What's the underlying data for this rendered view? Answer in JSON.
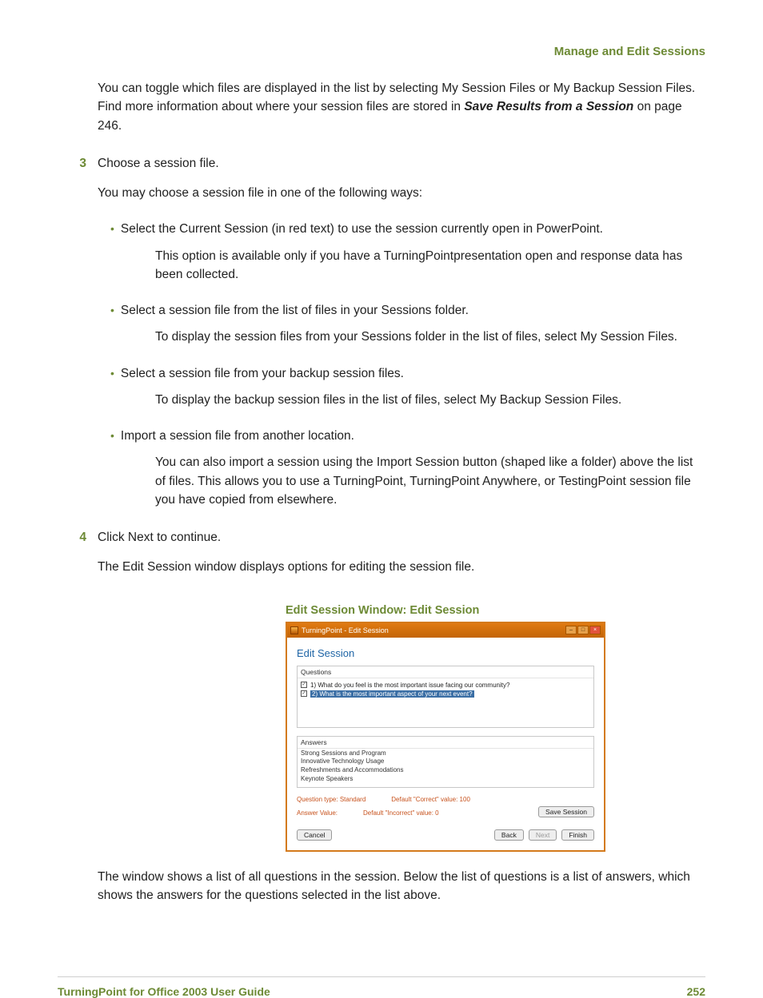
{
  "header": {
    "title": "Manage and Edit Sessions"
  },
  "intro": {
    "line1_a": "You can toggle which files are displayed in the list by selecting My Session Files or My Backup Session Files. Find more information about where your session files are stored in ",
    "xref": "Save Results from a Session",
    "line1_b": " on page 246."
  },
  "step3": {
    "num": "3",
    "title": "Choose a session file.",
    "lead": "You may choose a session file in one of the following ways:",
    "bullets": [
      {
        "t": "Select the Current Session (in red text) to use the session currently open in PowerPoint.",
        "s": "This option is available only if you have a TurningPointpresentation open and response data has been collected."
      },
      {
        "t": "Select a session file from the list of files in your Sessions folder.",
        "s": "To display the session files from your Sessions folder in the list of files, select My Session Files."
      },
      {
        "t": "Select a session file from your backup session files.",
        "s": "To display the backup session files in the list of files, select My Backup Session Files."
      },
      {
        "t": "Import a session file from another location.",
        "s": "You can also import a session using the Import Session button (shaped like a folder) above the list of files. This allows you to use a TurningPoint, TurningPoint Anywhere, or TestingPoint session file you have copied from elsewhere."
      }
    ]
  },
  "step4": {
    "num": "4",
    "title": "Click Next to continue.",
    "sub": "The Edit Session window displays options for editing the session file."
  },
  "figure": {
    "caption": "Edit Session Window: Edit Session",
    "titlebar": "TurningPoint - Edit Session",
    "heading": "Edit Session",
    "questions_label": "Questions",
    "questions": [
      "1) What do you feel is the most important issue facing our community?",
      "2) What is the most important aspect of your next event?"
    ],
    "answers_label": "Answers",
    "answers": [
      "Strong Sessions and Program",
      "Innovative Technology Usage",
      "Refreshments and Accommodations",
      "Keynote Speakers"
    ],
    "meta": {
      "qtype_label": "Question type: ",
      "qtype_value": "Standard",
      "correct": "Default \"Correct\" value: 100",
      "aval": "Answer Value:",
      "incorrect": "Default \"Incorrect\" value: 0"
    },
    "buttons": {
      "save": "Save Session",
      "cancel": "Cancel",
      "back": "Back",
      "next": "Next",
      "finish": "Finish"
    }
  },
  "after_figure": "The window shows a list of all questions in the session. Below the list of questions is a list of answers, which shows the answers for the questions selected in the list above.",
  "footer": {
    "guide": "TurningPoint for Office 2003 User Guide",
    "page": "252"
  }
}
